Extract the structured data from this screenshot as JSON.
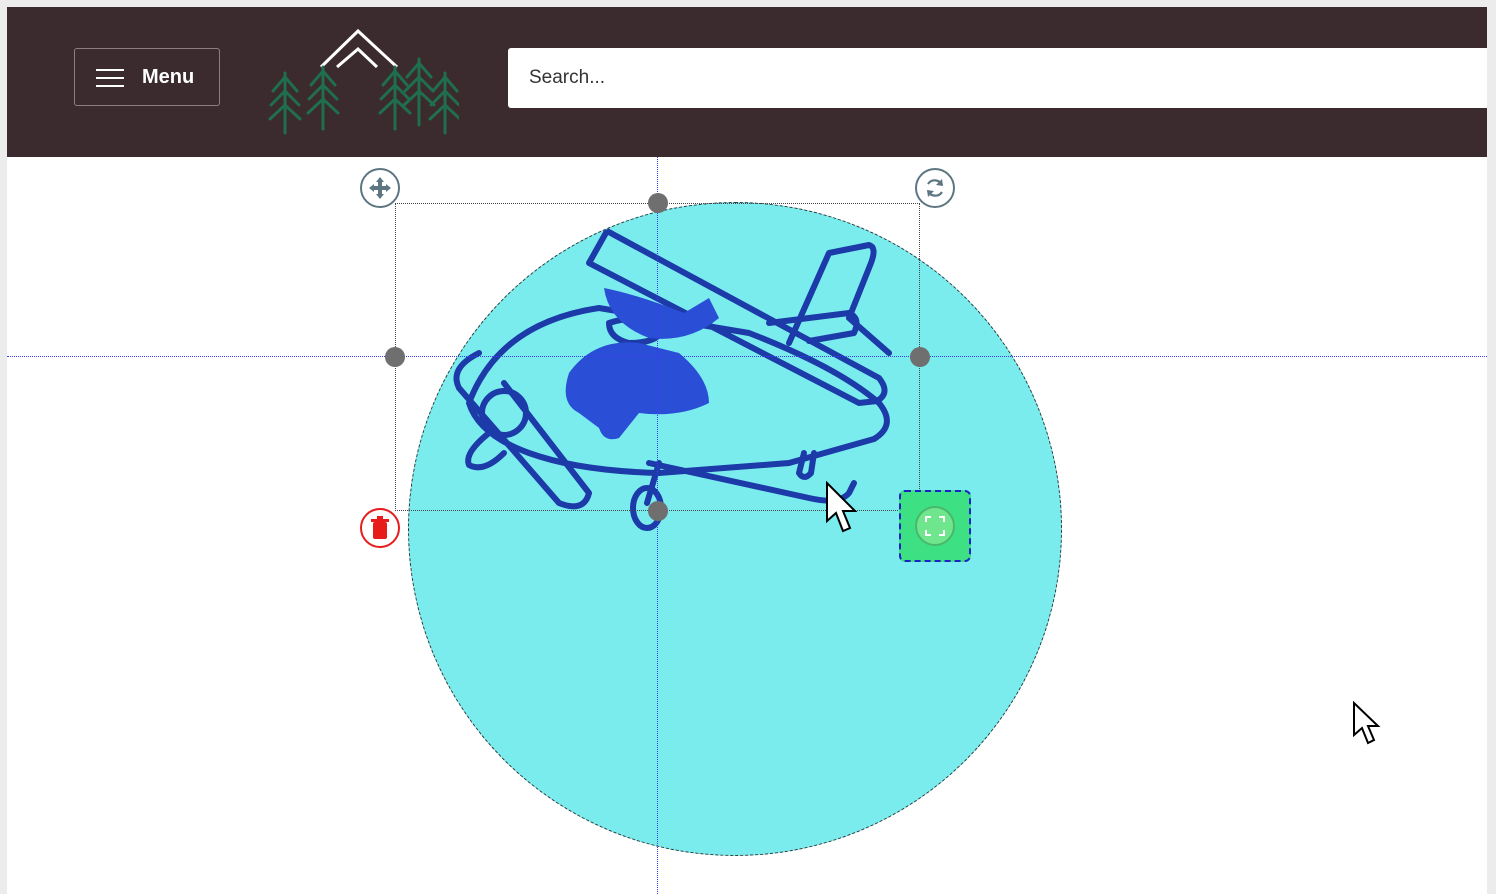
{
  "header": {
    "menu_label": "Menu",
    "search_placeholder": "Search...",
    "background_color": "#3b2b2f",
    "logo_icon": "mountain-pine-trees-logo"
  },
  "canvas": {
    "design_shape": "circle",
    "design_fill_color": "#7aecee",
    "artwork_icon": "airplane-line-art",
    "artwork_color": "#1c3aa8",
    "guide_color": "#3a3af0",
    "controls": {
      "move_icon": "move-arrows-icon",
      "rotate_icon": "rotate-icon",
      "delete_icon": "trash-icon",
      "resize_icon": "resize-expand-icon"
    },
    "resize_highlight_color": "#3ee084",
    "delete_color": "#e81b1b"
  }
}
